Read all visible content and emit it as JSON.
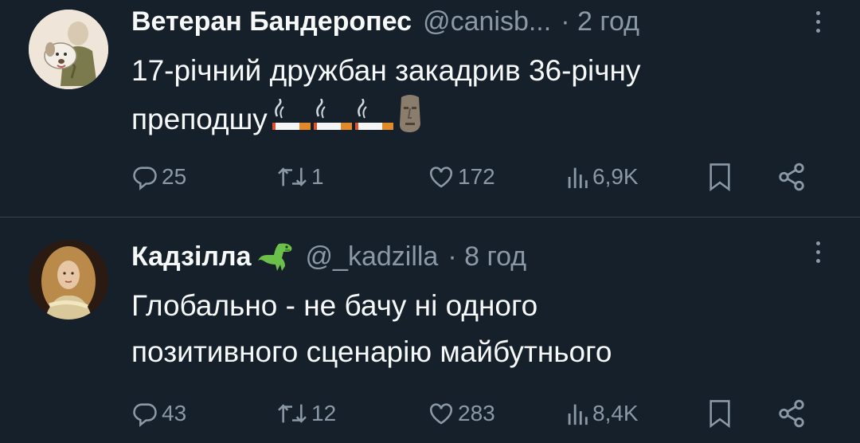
{
  "tweets": [
    {
      "name": "Ветеран Бандеропес",
      "handle": "@canisb...",
      "time": "· 2 год",
      "text_line1": "17-річний дружбан закадрив 36-річну",
      "text_line2": "преподшу",
      "emojis": [
        "cigarette-emoji",
        "cigarette-emoji",
        "cigarette-emoji",
        "moai-emoji"
      ],
      "replies": "25",
      "retweets": "1",
      "likes": "172",
      "views": "6,9K"
    },
    {
      "name": "Кадзілла",
      "name_emoji": "t-rex-emoji",
      "handle": "@_kadzilla",
      "time": "· 8 год",
      "text_line1": "Глобально - не бачу ні одного",
      "text_line2": "позитивного сценарію майбутнього",
      "replies": "43",
      "retweets": "12",
      "likes": "283",
      "views": "8,4K"
    }
  ],
  "colors": {
    "background": "#15202b",
    "text": "#f7f9f9",
    "secondary": "#8b98a5",
    "divider": "#38444d"
  }
}
